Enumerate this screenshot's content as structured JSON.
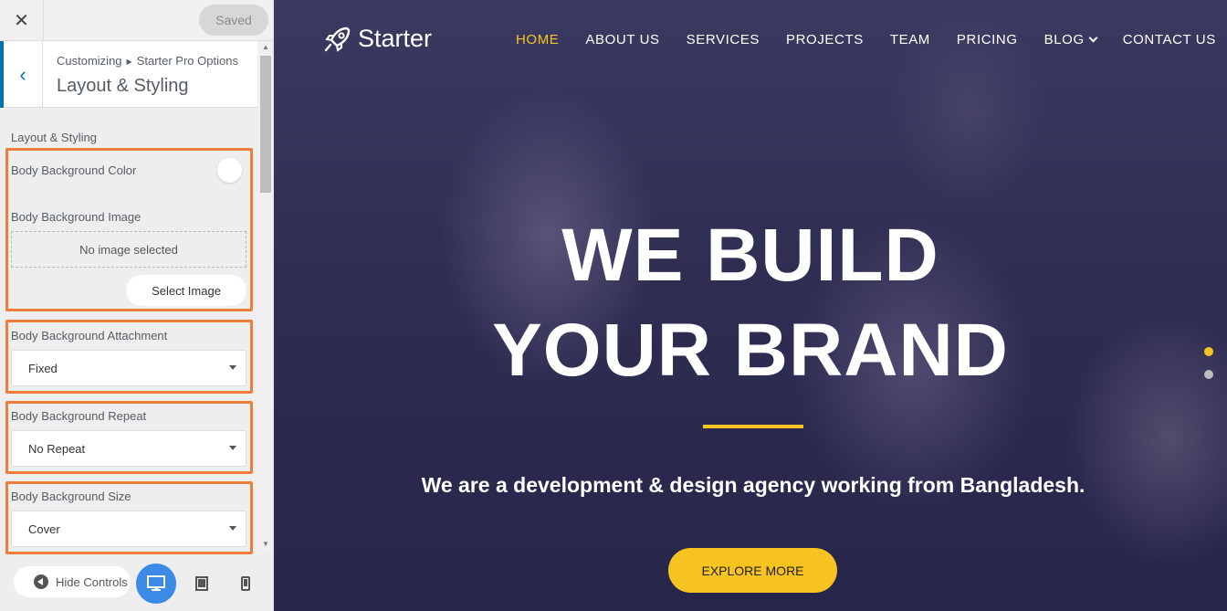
{
  "customizer": {
    "saved_label": "Saved",
    "breadcrumb": {
      "parent": "Customizing",
      "child": "Starter Pro Options"
    },
    "section_title": "Layout & Styling",
    "group_heading": "Layout & Styling",
    "fields": {
      "bg_color_label": "Body Background Color",
      "bg_image_label": "Body Background Image",
      "no_image_text": "No image selected",
      "select_image_label": "Select Image",
      "attachment_label": "Body Background Attachment",
      "attachment_value": "Fixed",
      "repeat_label": "Body Background Repeat",
      "repeat_value": "No Repeat",
      "size_label": "Body Background Size",
      "size_value": "Cover"
    },
    "footer": {
      "hide_controls_label": "Hide Controls"
    },
    "highlight_color": "#ef7d3a",
    "accent_color": "#0073aa"
  },
  "preview": {
    "logo_text": "Starter",
    "nav": [
      "HOME",
      "ABOUT US",
      "SERVICES",
      "PROJECTS",
      "TEAM",
      "PRICING",
      "BLOG",
      "CONTACT US"
    ],
    "active_nav": "HOME",
    "hero": {
      "line1": "WE BUILD",
      "line2": "YOUR BRAND",
      "subtitle": "We are a development & design agency working from Bangladesh.",
      "button": "EXPLORE MORE"
    },
    "accent_color": "#f7c320"
  }
}
